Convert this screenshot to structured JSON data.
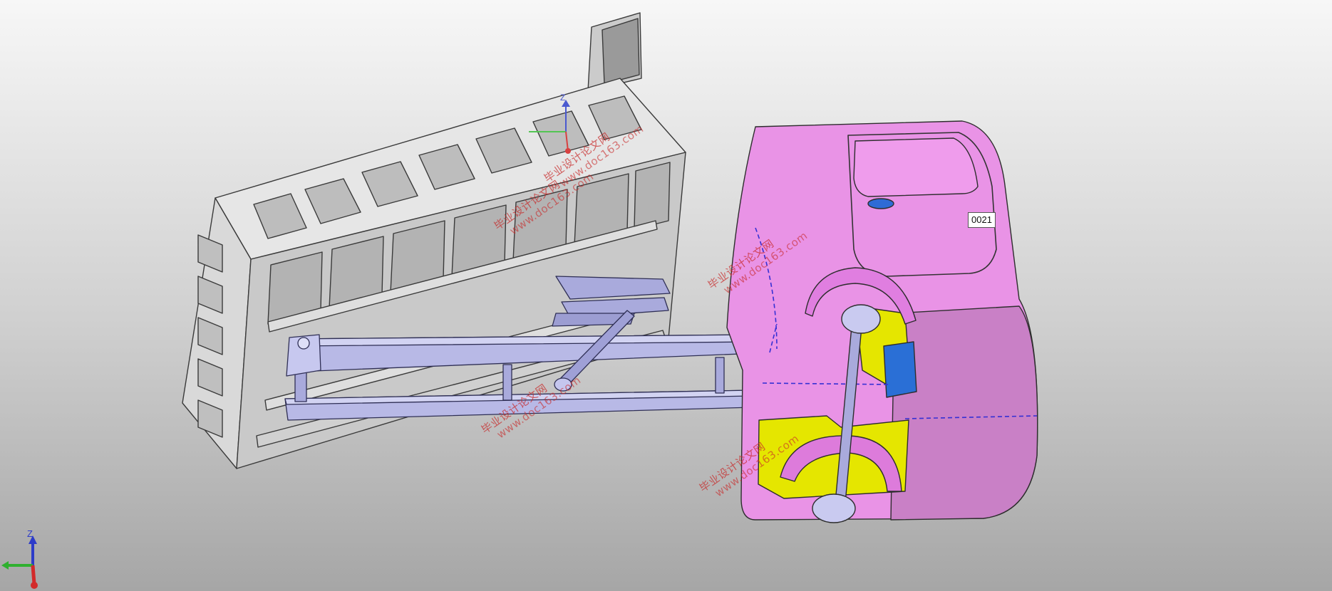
{
  "viewport": {
    "background_top": "#f7f7f7",
    "background_bottom": "#a6a6a6"
  },
  "model": {
    "dump_body_color": "#dcdcdc",
    "lift_frame_color": "#b8b9e6",
    "cab_color": "#e993e6",
    "cab_inner_color": "#e5e600",
    "part_tag": "0021"
  },
  "watermarks": [
    {
      "text": "毕业设计论文网",
      "url": "www.doc163.com"
    },
    {
      "text": "毕业设计论文网",
      "url": "www.doc163.com"
    },
    {
      "text": "毕业设计论文网",
      "url": "www.doc163.com"
    },
    {
      "text": "毕业设计论文网",
      "url": "www.doc163.com"
    },
    {
      "text": "毕业设计论文网",
      "url": "www.doc163.com"
    }
  ],
  "axis_triad": {
    "z_label": "Z",
    "x_color": "#d22a2a",
    "y_color": "#2fb02f",
    "z_color": "#2d3cc9"
  }
}
